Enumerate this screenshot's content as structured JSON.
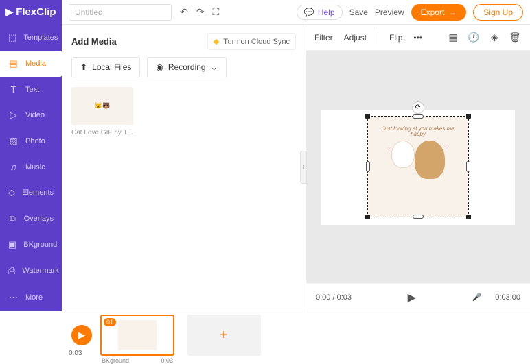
{
  "logo": "FlexClip",
  "project_title": "Untitled",
  "top": {
    "help": "Help",
    "save": "Save",
    "preview": "Preview",
    "export": "Export",
    "signup": "Sign Up"
  },
  "sidebar": {
    "items": [
      {
        "icon": "⬚",
        "label": "Templates"
      },
      {
        "icon": "▤",
        "label": "Media"
      },
      {
        "icon": "T",
        "label": "Text"
      },
      {
        "icon": "▷",
        "label": "Video"
      },
      {
        "icon": "▨",
        "label": "Photo"
      },
      {
        "icon": "♫",
        "label": "Music"
      },
      {
        "icon": "◇",
        "label": "Elements"
      },
      {
        "icon": "⧉",
        "label": "Overlays"
      },
      {
        "icon": "▣",
        "label": "BKground"
      },
      {
        "icon": "⎙",
        "label": "Watermark"
      }
    ],
    "more": "More"
  },
  "media": {
    "title": "Add Media",
    "cloud_sync": "Turn on Cloud Sync",
    "local_files": "Local Files",
    "recording": "Recording",
    "thumb_label": "Cat Love GIF by Tonton ...",
    "thumb_text": "Just looking at you makes me happy"
  },
  "context_bar": {
    "filter": "Filter",
    "adjust": "Adjust",
    "flip": "Flip",
    "tooltip": "Adjust Time"
  },
  "canvas": {
    "caption": "Just looking at you\nmakes me happy"
  },
  "controls": {
    "time_current": "0:00 / 0:03",
    "duration": "0:03.00"
  },
  "timeline": {
    "play_time": "0:03",
    "clip_badge": "01",
    "clip_label_left": "BKground",
    "clip_label_right": "0:03"
  }
}
